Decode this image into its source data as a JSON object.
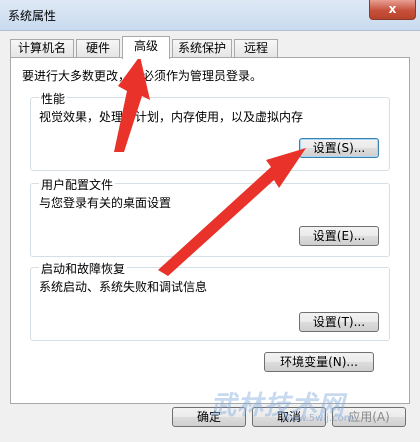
{
  "window": {
    "title": "系统属性",
    "close_glyph": "x"
  },
  "tabs": [
    {
      "label": "计算机名"
    },
    {
      "label": "硬件"
    },
    {
      "label": "高级",
      "active": true
    },
    {
      "label": "系统保护"
    },
    {
      "label": "远程"
    }
  ],
  "advanced": {
    "admin_notice": "要进行大多数更改，您必须作为管理员登录。",
    "performance": {
      "title": "性能",
      "description": "视觉效果，处理器计划，内存使用，以及虚拟内存",
      "settings_button": "设置(S)..."
    },
    "user_profiles": {
      "title": "用户配置文件",
      "description": "与您登录有关的桌面设置",
      "settings_button": "设置(E)..."
    },
    "startup_recovery": {
      "title": "启动和故障恢复",
      "description": "系统启动、系统失败和调试信息",
      "settings_button": "设置(T)..."
    },
    "env_button": "环境变量(N)..."
  },
  "footer": {
    "ok": "确定",
    "cancel": "取消",
    "apply": "应用(A)"
  },
  "watermark": {
    "text": "武林技术网",
    "sub": "www.5wlj.com"
  },
  "annotation": {
    "arrow_color": "#e8322a"
  }
}
